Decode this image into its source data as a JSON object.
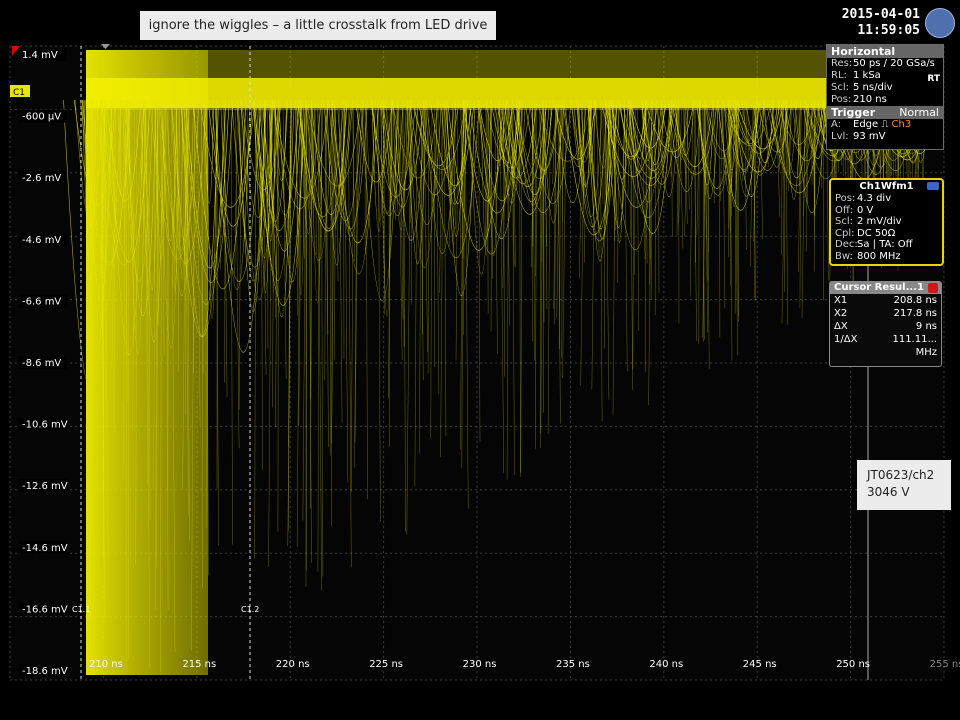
{
  "annotation": "ignore the wiggles – a little crosstalk from LED drive",
  "datetime": {
    "date": "2015-04-01",
    "time": "11:59:05"
  },
  "channel_label": "C1",
  "y_axis_labels": [
    "1.4 mV",
    "-600 µV",
    "-2.6 mV",
    "-4.6 mV",
    "-6.6 mV",
    "-8.6 mV",
    "-10.6 mV",
    "-12.6 mV",
    "-14.6 mV",
    "-16.6 mV",
    "-18.6 mV"
  ],
  "x_axis_labels": [
    "210 ns",
    "215 ns",
    "220 ns",
    "225 ns",
    "230 ns",
    "235 ns",
    "240 ns",
    "245 ns",
    "250 ns",
    "255 ns"
  ],
  "cursor_labels": {
    "c1": "C1.1",
    "c2": "C1.2"
  },
  "horizontal": {
    "title": "Horizontal",
    "rows": [
      {
        "k": "Res:",
        "v": "50 ps / 20 GSa/s"
      },
      {
        "k": "RL:",
        "v": "1 kSa"
      },
      {
        "k": "Scl:",
        "v": "5 ns/div"
      },
      {
        "k": "Pos:",
        "v": "210 ns"
      }
    ],
    "mode": "RT"
  },
  "trigger": {
    "title": "Trigger",
    "mode": "Normal",
    "rows": [
      {
        "k": "A:",
        "v": "Edge",
        "src": "Ch3"
      },
      {
        "k": "Lvl:",
        "v": "93 mV"
      }
    ]
  },
  "waveform": {
    "title": "Ch1Wfm1",
    "rows": [
      {
        "k": "Pos:",
        "v": "4.3 div"
      },
      {
        "k": "Off:",
        "v": "0 V"
      },
      {
        "k": "Scl:",
        "v": "2 mV/div"
      },
      {
        "k": "Cpl:",
        "v": "DC 50Ω"
      },
      {
        "k": "Dec:",
        "v": "Sa | TA: Off"
      },
      {
        "k": "Bw:",
        "v": "800 MHz"
      }
    ]
  },
  "cursor": {
    "title": "Cursor Resul...1",
    "rows": [
      {
        "k": "X1",
        "v": "208.8 ns"
      },
      {
        "k": "X2",
        "v": "217.8 ns"
      },
      {
        "k": "ΔX",
        "v": "9 ns"
      },
      {
        "k": "1/ΔX",
        "v": "111.11... MHz"
      }
    ]
  },
  "side_label": {
    "line1": "JT0623/ch2",
    "line2": "3046 V"
  },
  "colors": {
    "trace": "#e6e600",
    "bright": "#f5f000",
    "grid": "#444444",
    "accent": "#3a66c8",
    "close": "#d01818"
  }
}
